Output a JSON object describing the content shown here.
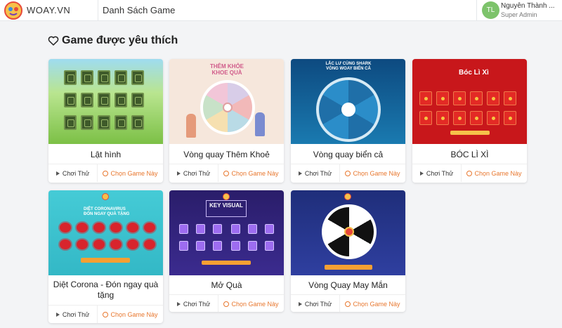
{
  "header": {
    "brand": "WOAY.VN",
    "page_title": "Danh Sách Game",
    "user": {
      "initials": "TL",
      "name": "Nguyễn Thành ...",
      "role": "Super Admin"
    }
  },
  "section": {
    "title": "Game được yêu thích"
  },
  "actions": {
    "play_label": "Chơi Thử",
    "choose_label": "Chọn Game Này"
  },
  "games": [
    {
      "title": "Lật hình"
    },
    {
      "title": "Vòng quay Thêm Khoẻ"
    },
    {
      "title": "Vòng quay biển cả"
    },
    {
      "title": "BÓC LÌ XÌ"
    },
    {
      "title": "Diệt Corona - Đón ngay quà tặng"
    },
    {
      "title": "Mở Quà"
    },
    {
      "title": "Vòng Quay May Mắn"
    }
  ],
  "colors": {
    "accent": "#e8772e",
    "avatar": "#7dc36b",
    "background": "#f3f4f6"
  }
}
